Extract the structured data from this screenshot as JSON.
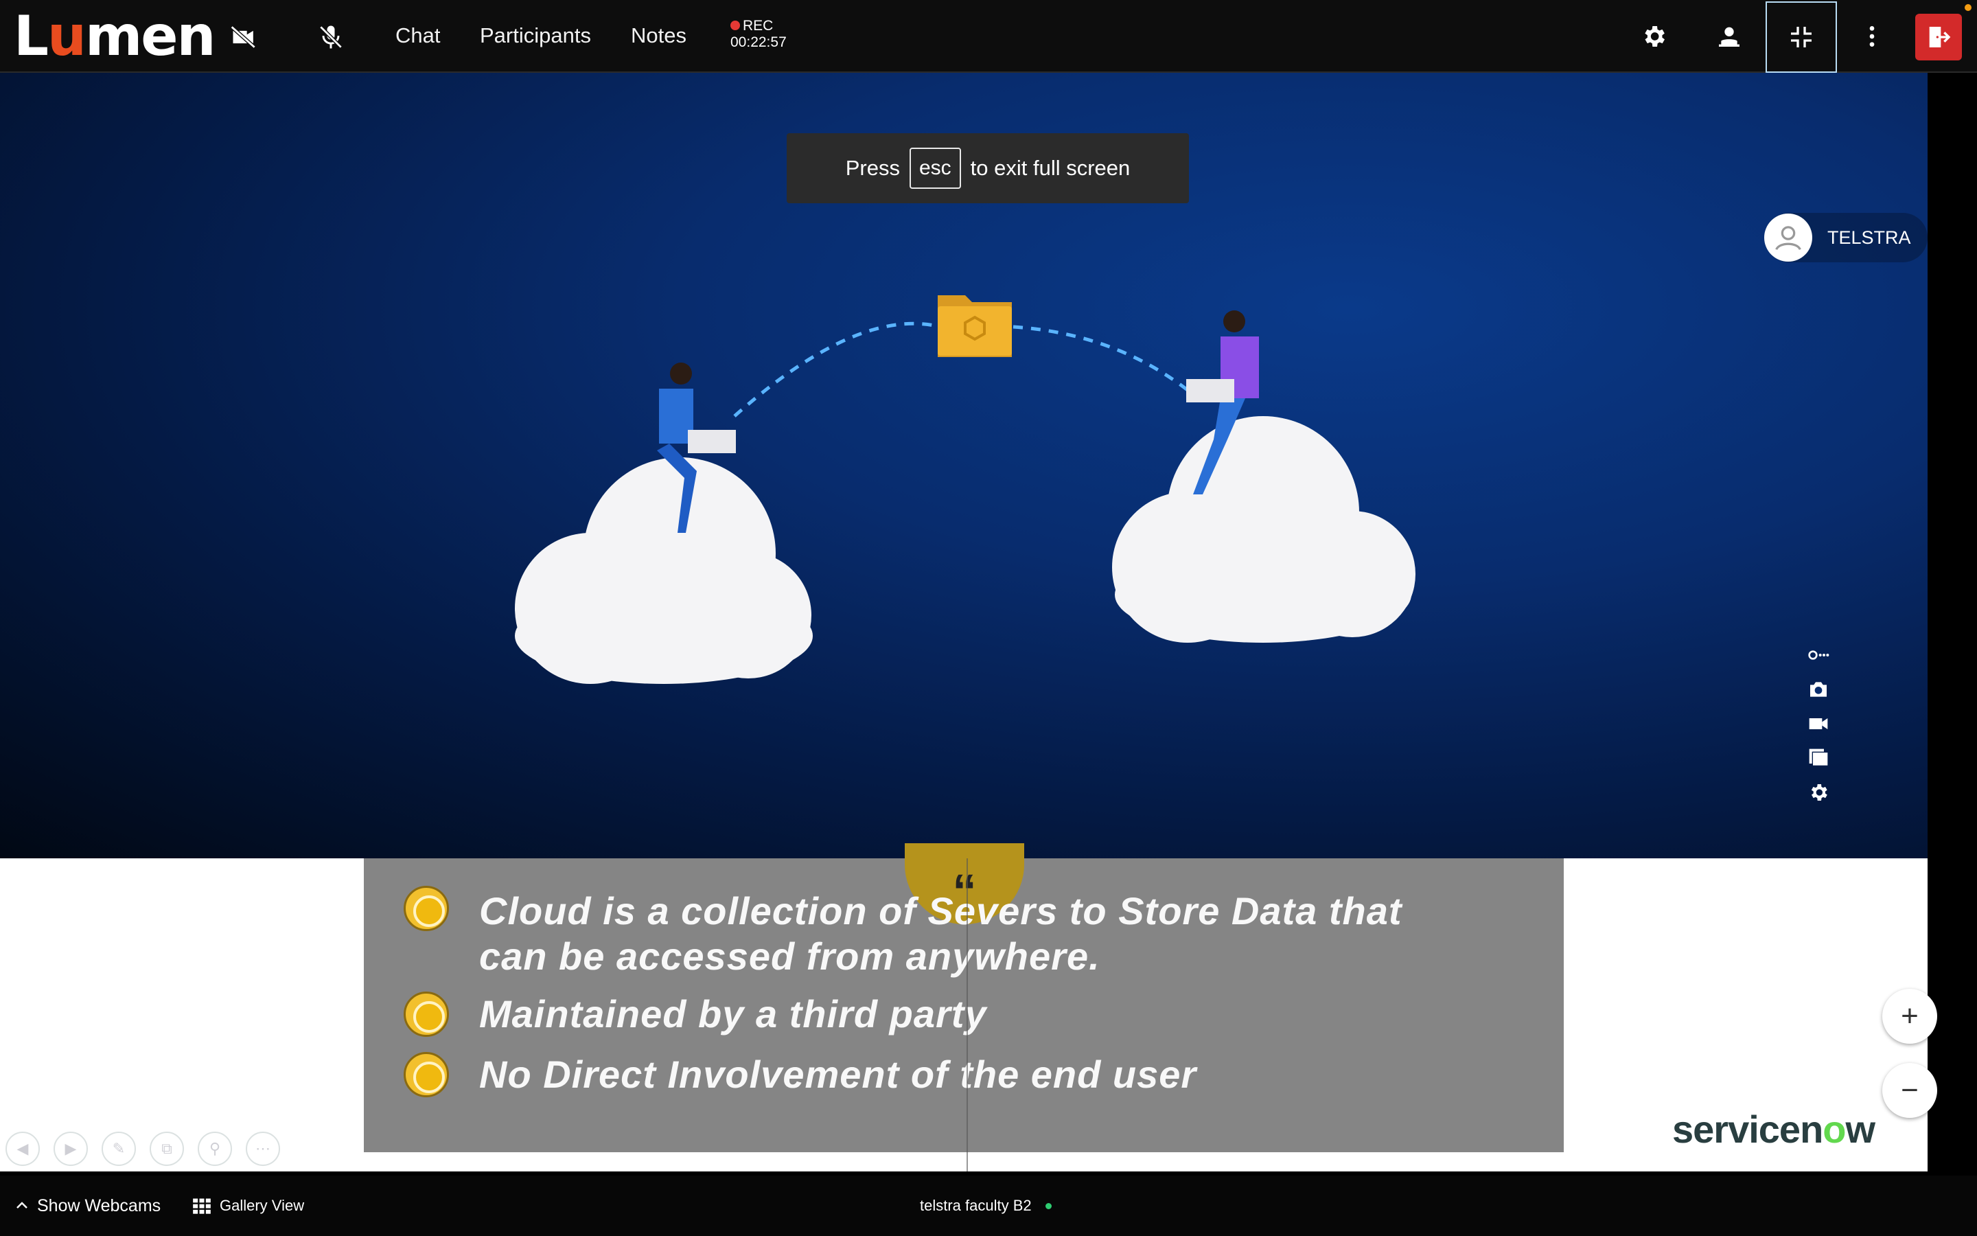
{
  "header": {
    "logo_text": "Lumen",
    "nav": {
      "chat": "Chat",
      "participants": "Participants",
      "notes": "Notes"
    },
    "recording": {
      "label": "REC",
      "time": "00:22:57"
    },
    "icons": [
      "camera-off-icon",
      "mic-off-icon",
      "settings-icon",
      "raise-hand-icon",
      "exit-fullscreen-icon",
      "more-icon",
      "leave-icon"
    ]
  },
  "toast": {
    "press": "Press",
    "key": "esc",
    "message": "to exit full screen"
  },
  "presenter": {
    "name": "TELSTRA"
  },
  "slide": {
    "quote_mark": "“",
    "bullets": [
      {
        "line1": "Cloud is a collection of Severs to Store Data that",
        "line2": "can be accessed from anywhere."
      },
      {
        "line1": "Maintained by a third party"
      },
      {
        "line1": "No Direct Involvement of the end user"
      }
    ],
    "brand": {
      "pre": "servicen",
      "o": "o",
      "post": "w"
    }
  },
  "zoom": {
    "plus": "+",
    "minus": "−"
  },
  "footer": {
    "show_webcams": "Show Webcams",
    "gallery_view": "Gallery View",
    "session_name": "telstra faculty B2"
  },
  "colors": {
    "accent_red": "#d32a2a",
    "logo_orange": "#e84c1f",
    "bullet_yellow": "#f2c02d",
    "brand_green": "#62d84e"
  }
}
